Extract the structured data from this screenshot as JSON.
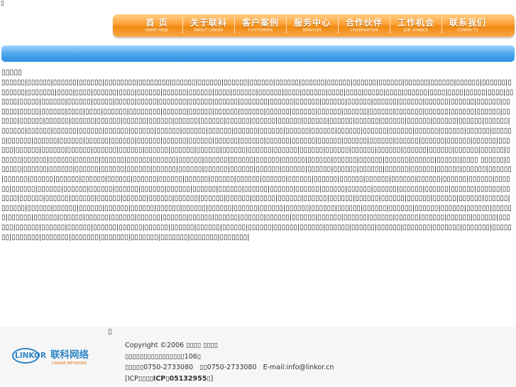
{
  "top_marker": "▯",
  "nav": {
    "items": [
      {
        "zh": "首 页",
        "en": "HOME PAGE"
      },
      {
        "zh": "关于联科",
        "en": "ABOUT LINKOR"
      },
      {
        "zh": "客户案例",
        "en": "CUSTOMERS"
      },
      {
        "zh": "服务中心",
        "en": "SERVICES"
      },
      {
        "zh": "合作伙伴",
        "en": "COOPERATION"
      },
      {
        "zh": "工作机会",
        "en": "JOB CHANCE"
      },
      {
        "zh": "联系我们",
        "en": "CONTACTS"
      }
    ]
  },
  "article": {
    "title": "▯▯▯▯▯",
    "body_part1": "▯▯▯▯▯▯|▯▯▯▯▯▯|▯▯▯▯▯▯|▯▯▯▯▯▯|▯▯▯▯▯▯▯▯|▯▯▯▯▯▯▯▯|▯▯▯▯▯▯|▯▯▯▯▯▯|▯▯▯▯▯▯|▯▯▯▯▯▯|▯▯▯▯▯▯|▯▯▯▯▯▯|▯▯▯▯▯▯|▯▯▯▯▯▯|▯▯▯▯▯▯|▯▯▯▯▯▯|▯▯▯▯▯▯|▯▯▯▯▯▯|▯▯▯▯▯▯|▯▯▯▯▯▯▯|▯▯▯▯▯▯▯|▯▯▯▯|▯▯▯▯|▯▯▯▯▯▯|▯▯▯▯|▯▯▯▯▯▯|▯▯▯▯▯▯|▯▯▯▯▯▯|▯▯▯▯|▯▯▯▯▯▯|▯▯▯▯▯▯|▯▯▯▯|▯▯▯▯▯▯|▯▯▯▯|▯▯▯▯|▯▯▯▯▯|▯▯▯▯|▯▯▯▯▯▯|▯▯▯▯|▯▯▯▯|▯▯▯▯▯|▯▯▯▯|▯▯▯▯▯▯|▯▯▯▯▯|▯▯▯▯▯▯|▯▯▯▯▯▯|▯▯▯▯▯|▯▯▯▯▯|▯▯▯▯▯|▯▯▯▯▯▯▯|▯▯▯▯▯▯|▯▯▯▯▯▯|▯▯▯▯▯▯▯|▯▯▯▯▯▯|▯▯▯▯▯▯|▯▯▯▯▯▯|▯▯▯▯▯▯|▯▯▯▯▯▯|▯▯▯▯▯▯|▯▯▯▯▯▯|▯▯▯▯▯▯|▯▯▯▯▯▯|▯▯▯▯▯▯|▯▯▯▯▯|▯▯▯▯▯▯|▯▯▯▯|▯▯▯▯|▯▯▯▯▯▯|▯▯▯▯▯▯▯▯|▯▯▯▯▯▯|▯▯▯▯▯▯|▯▯▯▯▯▯|▯▯▯▯▯▯|▯▯▯▯▯▯|▯▯▯▯▯▯|▯▯▯▯▯▯|▯▯▯▯▯▯|▯▯▯▯▯▯|▯▯▯▯▯▯▯|▯▯▯▯▯▯|▯▯▯▯▯▯|▯▯▯▯▯▯|▯▯▯▯▯▯|▯▯▯▯▯▯|▯▯▯▯▯▯|▯▯▯▯▯▯|▯▯▯▯▯▯|▯▯▯▯▯▯|▯▯▯▯▯▯|▯▯▯▯▯▯|▯▯▯▯▯▯|▯▯▯▯▯▯|▯▯▯▯▯▯|▯▯▯▯▯▯|▯▯▯▯▯▯|▯▯▯▯▯▯|▯▯▯▯▯▯|▯▯▯▯▯▯|▯▯▯▯▯▯|▯▯▯▯▯▯|▯▯▯▯▯▯|▯▯▯▯▯▯|▯▯▯▯▯▯|▯▯▯▯▯▯|▯▯▯▯▯▯|▯▯▯▯▯▯|▯▯▯▯▯▯|▯▯▯▯▯▯|▯▯▯▯▯▯|▯▯▯▯▯▯|▯▯▯▯▯▯|▯▯▯▯▯▯|▯▯▯▯▯▯|▯▯▯▯▯▯|▯▯▯▯▯▯|▯▯▯▯▯▯|▯▯▯▯▯▯|▯▯▯▯▯▯|▯▯▯▯▯▯|▯▯▯▯▯▯|▯▯▯▯▯▯|▯▯▯▯▯▯|▯▯▯▯▯▯|▯▯▯▯▯▯|▯▯▯▯▯▯|▯▯▯▯▯▯|▯▯▯▯▯▯|▯▯▯▯▯▯|▯▯▯▯▯▯|▯▯▯▯▯▯|▯▯▯▯▯▯|▯▯▯▯▯▯|▯▯▯▯▯▯|▯▯▯▯▯▯|▯▯▯▯▯▯|▯▯▯▯▯▯|▯▯▯▯▯▯|▯▯▯▯▯▯|▯▯▯▯▯▯|▯▯▯▯▯▯|▯▯▯▯▯▯|▯▯▯▯▯▯|▯▯▯▯▯▯|▯▯▯▯▯▯|▯▯▯▯▯▯|▯▯▯▯▯▯|▯▯▯▯▯▯|▯▯▯▯▯▯|▯▯▯▯▯▯|▯▯▯▯▯▯|▯▯▯▯▯▯|▯▯▯▯▯▯|▯▯▯▯▯▯|▯▯▯▯▯▯|▯▯▯▯▯▯|▯▯▯▯▯▯|▯▯▯▯▯▯|▯▯▯▯▯▯|▯▯▯▯▯▯|▯▯▯▯▯▯|▯▯▯▯▯▯|▯▯▯▯▯▯|▯▯▯▯▯▯|▯▯▯▯▯▯|▯▯▯▯▯▯|▯▯▯▯▯▯|▯▯▯▯▯▯|▯▯▯▯▯▯|▯▯▯▯▯▯|▯▯▯▯▯▯|▯▯▯▯▯▯|▯▯▯▯▯▯|▯▯▯▯▯▯|▯▯▯▯▯▯|▯▯▯▯▯▯|▯▯▯▯▯▯|▯▯▯▯▯▯|▯▯▯▯▯▯|▯▯▯▯▯▯|",
    "body_bold": "▯▯▯▯ ▯▯▯▯▯▯",
    "body_part2": "|▯▯▯▯▯▯|▯▯▯▯▯▯|▯▯▯▯▯▯|▯▯▯▯▯▯|▯▯▯▯▯▯|▯▯▯▯▯▯|▯▯▯▯▯▯|▯▯▯▯▯▯|▯▯▯▯▯▯|▯▯▯▯▯▯|▯▯▯▯▯▯|▯▯▯▯▯▯|▯▯▯▯▯▯|▯▯▯▯▯▯|▯▯▯▯▯▯|▯▯▯▯▯▯|▯▯▯▯▯▯|▯▯▯▯▯▯|▯▯▯▯▯▯|▯▯▯▯▯▯|▯▯▯▯▯▯|▯▯▯▯▯▯|▯▯▯▯▯▯|▯▯▯▯▯▯|▯▯▯▯▯▯|▯▯▯▯▯▯|▯▯▯▯▯▯|▯▯▯▯▯▯|▯▯▯▯▯▯|▯▯▯▯▯▯|▯▯▯▯▯▯|▯▯▯▯▯▯|▯▯▯▯▯▯|▯▯▯▯▯▯|▯▯▯▯▯▯|▯▯▯▯▯▯|▯▯▯▯▯▯|▯▯▯▯▯▯|▯▯▯▯▯▯|▯▯▯▯▯▯|▯▯▯▯▯▯|▯▯▯▯▯▯|▯▯▯▯▯▯|▯▯▯▯▯▯|▯▯▯▯▯▯|▯▯▯▯▯▯|▯▯▯▯▯▯|▯▯▯▯▯▯|▯▯▯▯▯▯|▯▯▯▯▯▯|▯▯▯▯▯▯|▯▯▯▯▯▯|▯▯▯▯▯▯|▯▯▯▯▯▯|▯▯▯▯▯▯|▯▯▯▯▯▯|▯▯▯▯▯▯|▯▯▯▯▯▯|▯▯▯▯▯▯|▯▯▯▯▯▯|▯▯▯▯▯▯|▯▯▯▯▯▯|▯▯▯▯▯▯|▯▯▯▯▯▯|▯▯▯▯▯▯|▯▯▯▯▯▯|▯▯▯▯▯▯|▯▯▯▯▯▯|▯▯▯▯▯▯|▯▯▯▯▯▯|▯▯▯▯▯▯|▯▯▯▯▯▯|▯▯▯▯▯▯|▯▯▯▯▯▯|▯▯▯▯▯▯|▯▯▯▯▯▯|▯▯▯▯▯▯|▯▯▯▯▯▯|▯▯▯▯▯▯|▯▯▯▯▯▯|▯▯▯▯▯▯|▯▯▯▯▯▯|▯▯▯▯▯▯|▯▯▯▯▯▯|▯▯▯▯▯▯|▯▯▯▯▯▯|▯▯▯▯▯▯|▯▯▯▯▯▯|▯▯▯▯▯▯|▯▯▯▯▯▯|▯▯▯▯▯▯|▯▯▯▯▯▯|▯▯▯▯▯▯|▯▯▯▯▯▯|▯▯▯▯▯▯|▯▯▯▯▯▯|▯▯▯▯▯▯|▯▯▯▯▯▯|▯▯▯▯▯▯|▯▯▯▯▯▯|▯▯▯▯▯▯|▯▯▯▯▯▯|▯▯▯▯▯▯|▯▯▯▯▯▯|▯▯▯▯▯▯|▯▯▯▯▯▯|▯▯▯▯▯▯|▯▯▯▯▯▯|▯▯▯▯▯▯|▯▯▯▯▯▯|▯▯▯▯▯▯|▯▯▯▯▯▯|▯▯▯▯▯▯|▯▯▯▯▯▯|▯▯▯▯▯▯|▯▯▯▯▯▯|▯▯▯▯▯▯|▯▯▯▯▯▯|▯▯▯▯▯▯|▯▯▯▯▯▯|▯▯▯▯▯▯|▯▯▯▯▯▯|▯▯▯▯▯▯|▯▯▯▯▯▯|▯▯▯▯▯▯|▯▯▯▯▯▯|▯▯▯▯▯▯|▯▯▯▯▯▯|▯▯▯▯▯▯|▯▯▯▯▯▯|▯▯▯▯▯▯|▯▯▯▯▯▯|▯▯▯▯▯▯|▯▯▯▯▯▯|▯▯▯▯▯▯▯|▯▯▯▯▯▯▯|▯▯▯▯▯▯▯|▯▯▯▯▯▯▯|▯▯▯▯▯▯▯|▯▯▯▯▯▯▯|▯▯▯▯▯▯▯|▯▯▯▯▯▯▯|▯▯▯▯▯▯▯|▯▯▯▯▯▯▯|▯▯▯▯▯▯▯|▯▯▯▯▯▯▯|"
  },
  "footer": {
    "marker": "▯",
    "logo_text_en": "LINKOR",
    "logo_text_zh": "联科网络",
    "logo_subtext": "LINKOR NETWORK",
    "copyright": "Copyright ©2006 ▯▯▯▯ ▯▯▯▯",
    "address": "▯▯▯▯▯▯▯▯▯▯▯▯▯▯▯▯106▯",
    "phone_label": "▯▯▯▯▯",
    "phone": "0750-2733080",
    "fax_label": "▯▯",
    "fax": "0750-2733080",
    "email": "E-mail:info@linkor.cn",
    "icp_prefix": "[ICP▯▯▯▯",
    "icp_bold": "ICP▯05132955",
    "icp_suffix": "▯]"
  }
}
